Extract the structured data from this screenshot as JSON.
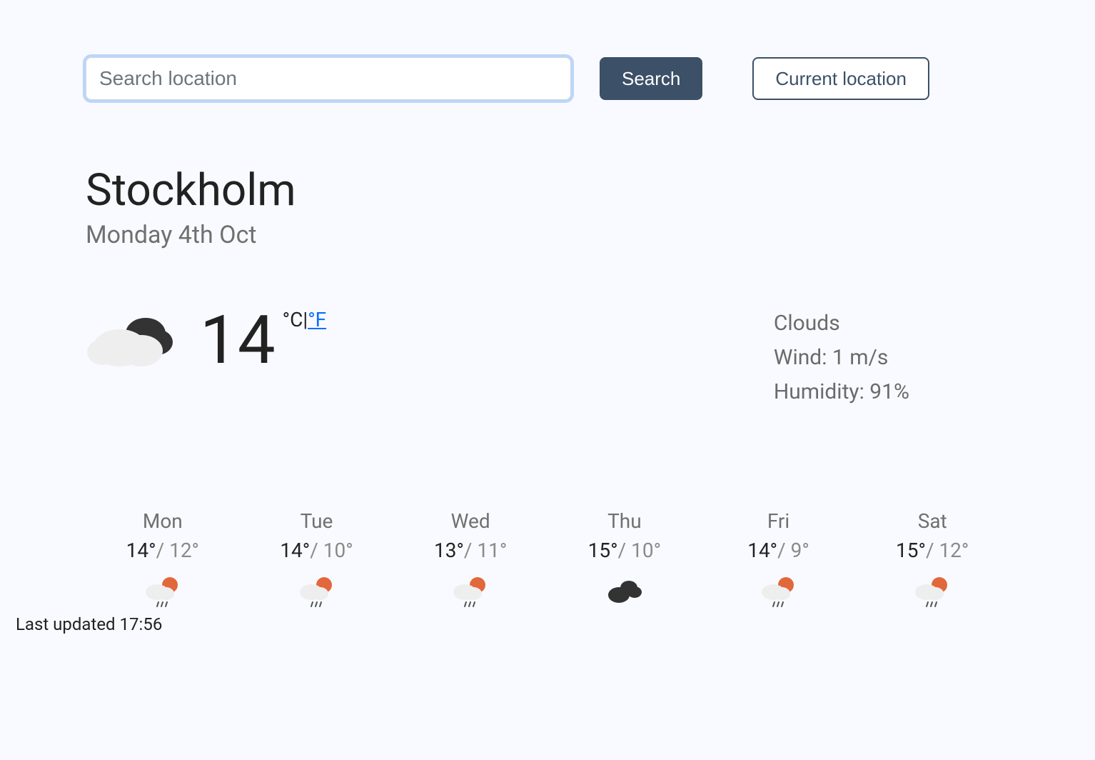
{
  "search": {
    "placeholder": "Search location",
    "value": "",
    "search_button": "Search",
    "current_location_button": "Current location"
  },
  "location": {
    "city": "Stockholm",
    "date": "Monday 4th Oct"
  },
  "current": {
    "temp": "14",
    "unit_c": "°C",
    "unit_sep": "|",
    "unit_f": "°F",
    "condition": "Clouds",
    "wind_label": "Wind: 1 m/s",
    "humidity_label": "Humidity: 91%",
    "icon": "cloudy"
  },
  "forecast": [
    {
      "day": "Mon",
      "high": "14°",
      "low": "12°",
      "icon": "rain-sun"
    },
    {
      "day": "Tue",
      "high": "14°",
      "low": "10°",
      "icon": "rain-sun"
    },
    {
      "day": "Wed",
      "high": "13°",
      "low": "11°",
      "icon": "rain-sun"
    },
    {
      "day": "Thu",
      "high": "15°",
      "low": "10°",
      "icon": "cloudy"
    },
    {
      "day": "Fri",
      "high": "14°",
      "low": "9°",
      "icon": "rain-sun"
    },
    {
      "day": "Sat",
      "high": "15°",
      "low": "12°",
      "icon": "rain-sun"
    }
  ],
  "footer": {
    "last_updated": "Last updated 17:56"
  }
}
